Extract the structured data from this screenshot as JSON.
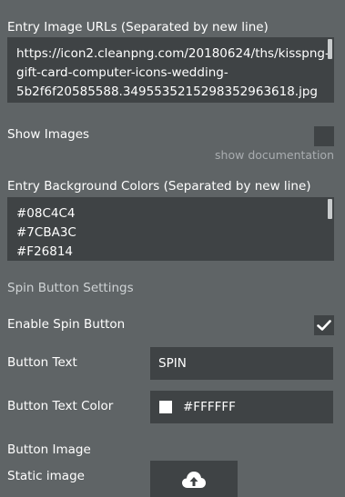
{
  "entry_images": {
    "label": "Entry Image URLs (Separated by new line)",
    "lines": [
      "https://icon2.cleanpng.com/20180624/ths/kisspng-",
      "gift-card-computer-icons-wedding-",
      "5b2f6f20585588.3495535215298352963618.jpg"
    ]
  },
  "show_images": {
    "label": "Show Images",
    "checked": false,
    "doc_link": "show documentation"
  },
  "entry_colors": {
    "label": "Entry Background Colors (Separated by new line)",
    "lines": [
      "#08C4C4",
      "#7CBA3C",
      "#F26814"
    ]
  },
  "spin_settings": {
    "section_title": "Spin Button Settings",
    "enable_label": "Enable Spin Button",
    "enable_checked": true,
    "button_text_label": "Button Text",
    "button_text_value": "SPIN",
    "button_text_color_label": "Button Text Color",
    "button_text_color_value": "#FFFFFF",
    "button_text_color_swatch": "#FFFFFF",
    "button_image_label": "Button Image",
    "static_image_label": "Static image"
  },
  "colors": {
    "panel_bg": "#5f6466",
    "field_bg": "#3f4345",
    "muted_text": "#a9adb0"
  },
  "icons": {
    "checkmark": "check-icon",
    "upload": "cloud-upload-icon"
  }
}
